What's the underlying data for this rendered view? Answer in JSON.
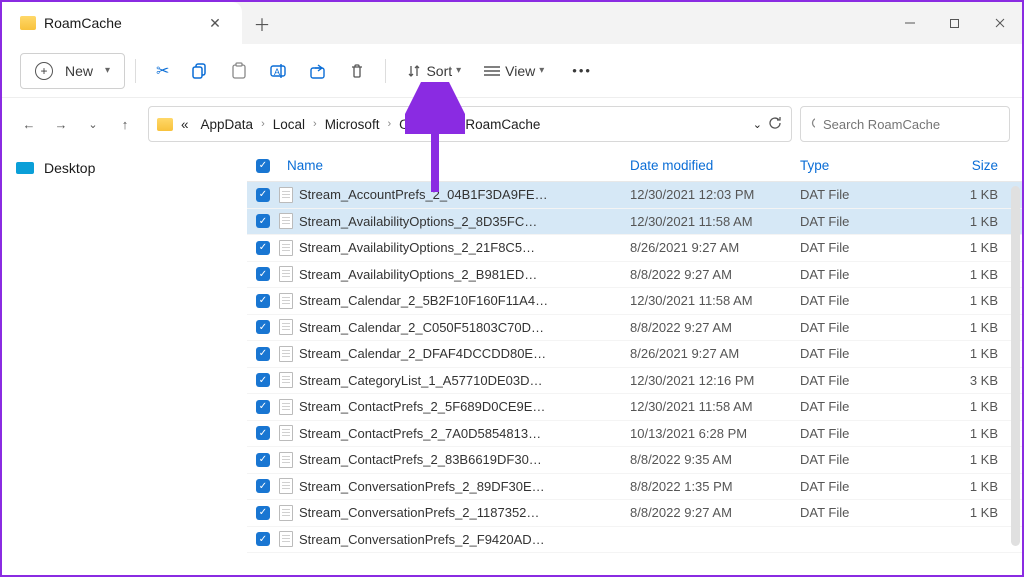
{
  "tab": {
    "title": "RoamCache"
  },
  "toolbar": {
    "new_label": "New",
    "sort_label": "Sort",
    "view_label": "View"
  },
  "breadcrumbs": {
    "prefix": "«",
    "items": [
      "AppData",
      "Local",
      "Microsoft",
      "Outlook",
      "RoamCache"
    ]
  },
  "search": {
    "placeholder": "Search RoamCache"
  },
  "sidebar": {
    "items": [
      {
        "label": "Desktop"
      }
    ]
  },
  "columns": {
    "name": "Name",
    "date": "Date modified",
    "type": "Type",
    "size": "Size"
  },
  "files": [
    {
      "name": "Stream_AccountPrefs_2_04B1F3DA9FE…",
      "date": "12/30/2021 12:03 PM",
      "type": "DAT File",
      "size": "1 KB",
      "sel": true
    },
    {
      "name": "Stream_AvailabilityOptions_2_8D35FC…",
      "date": "12/30/2021 11:58 AM",
      "type": "DAT File",
      "size": "1 KB",
      "sel": true
    },
    {
      "name": "Stream_AvailabilityOptions_2_21F8C5…",
      "date": "8/26/2021 9:27 AM",
      "type": "DAT File",
      "size": "1 KB",
      "sel": false
    },
    {
      "name": "Stream_AvailabilityOptions_2_B981ED…",
      "date": "8/8/2022 9:27 AM",
      "type": "DAT File",
      "size": "1 KB",
      "sel": false
    },
    {
      "name": "Stream_Calendar_2_5B2F10F160F11A4…",
      "date": "12/30/2021 11:58 AM",
      "type": "DAT File",
      "size": "1 KB",
      "sel": false
    },
    {
      "name": "Stream_Calendar_2_C050F51803C70D…",
      "date": "8/8/2022 9:27 AM",
      "type": "DAT File",
      "size": "1 KB",
      "sel": false
    },
    {
      "name": "Stream_Calendar_2_DFAF4DCCDD80E…",
      "date": "8/26/2021 9:27 AM",
      "type": "DAT File",
      "size": "1 KB",
      "sel": false
    },
    {
      "name": "Stream_CategoryList_1_A57710DE03D…",
      "date": "12/30/2021 12:16 PM",
      "type": "DAT File",
      "size": "3 KB",
      "sel": false
    },
    {
      "name": "Stream_ContactPrefs_2_5F689D0CE9E…",
      "date": "12/30/2021 11:58 AM",
      "type": "DAT File",
      "size": "1 KB",
      "sel": false
    },
    {
      "name": "Stream_ContactPrefs_2_7A0D5854813…",
      "date": "10/13/2021 6:28 PM",
      "type": "DAT File",
      "size": "1 KB",
      "sel": false
    },
    {
      "name": "Stream_ContactPrefs_2_83B6619DF30…",
      "date": "8/8/2022 9:35 AM",
      "type": "DAT File",
      "size": "1 KB",
      "sel": false
    },
    {
      "name": "Stream_ConversationPrefs_2_89DF30E…",
      "date": "8/8/2022 1:35 PM",
      "type": "DAT File",
      "size": "1 KB",
      "sel": false
    },
    {
      "name": "Stream_ConversationPrefs_2_1187352…",
      "date": "8/8/2022 9:27 AM",
      "type": "DAT File",
      "size": "1 KB",
      "sel": false
    },
    {
      "name": "Stream_ConversationPrefs_2_F9420AD…",
      "date": "",
      "type": "",
      "size": "",
      "sel": false
    }
  ]
}
